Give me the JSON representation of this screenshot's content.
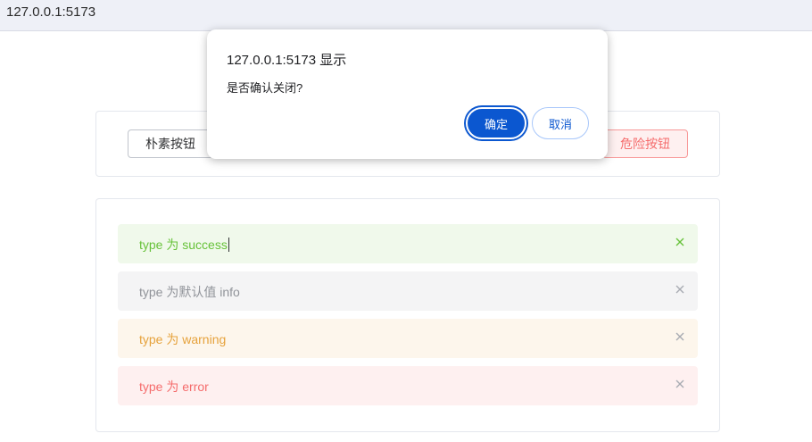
{
  "browser": {
    "url": "127.0.0.1:5173"
  },
  "buttons": {
    "plain_label": "朴素按钮",
    "danger_label": "危险按钮"
  },
  "alerts": [
    {
      "type": "success",
      "text": "type 为 success"
    },
    {
      "type": "info",
      "text": "type 为默认值 info"
    },
    {
      "type": "warning",
      "text": "type 为 warning"
    },
    {
      "type": "error",
      "text": "type 为 error"
    }
  ],
  "dialog": {
    "title": "127.0.0.1:5173 显示",
    "message": "是否确认关闭?",
    "ok_label": "确定",
    "cancel_label": "取消"
  },
  "colors": {
    "success": "#67c23a",
    "info": "#909399",
    "warning": "#e6a23c",
    "error": "#f56c6c",
    "dialog_accent": "#0b57d0"
  },
  "icons": {
    "alert_close": "close-icon"
  }
}
